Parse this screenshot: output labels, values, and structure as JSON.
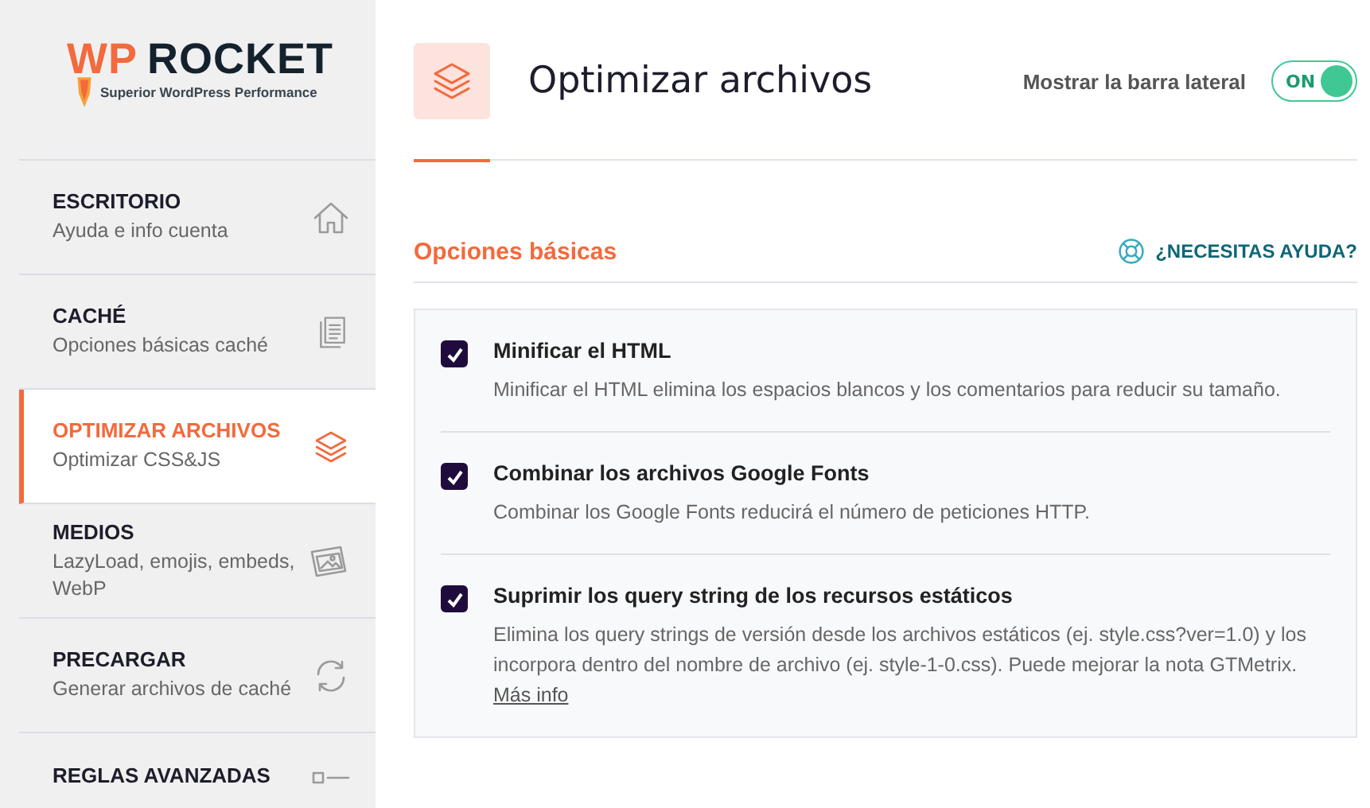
{
  "logo": {
    "brand_accent": "WP",
    "brand": "ROCKET",
    "tagline": "Superior WordPress Performance"
  },
  "sidebar": {
    "items": [
      {
        "title": "ESCRITORIO",
        "subtitle": "Ayuda e info cuenta",
        "selected": false
      },
      {
        "title": "CACHÉ",
        "subtitle": "Opciones básicas caché",
        "selected": false
      },
      {
        "title": "OPTIMIZAR ARCHIVOS",
        "subtitle": "Optimizar CSS&JS",
        "selected": true
      },
      {
        "title": "MEDIOS",
        "subtitle": "LazyLoad, emojis, embeds, WebP",
        "selected": false
      },
      {
        "title": "PRECARGAR",
        "subtitle": "Generar archivos de caché",
        "selected": false
      },
      {
        "title": "REGLAS AVANZADAS",
        "selected": false
      }
    ]
  },
  "header": {
    "title": "Optimizar archivos",
    "sidebar_toggle": {
      "label": "Mostrar la barra lateral",
      "state_text": "ON",
      "on": true
    }
  },
  "section": {
    "title": "Opciones básicas",
    "help_link": "¿NECESITAS AYUDA?",
    "options": [
      {
        "title": "Minificar el HTML",
        "description": "Minificar el HTML elimina los espacios blancos y los comentarios para reducir su tamaño.",
        "checked": true
      },
      {
        "title": "Combinar los archivos Google Fonts",
        "description": "Combinar los Google Fonts reducirá el número de peticiones HTTP.",
        "checked": true
      },
      {
        "title": "Suprimir los query string de los recursos estáticos",
        "description": "Elimina los query strings de versión desde los archivos estáticos (ej. style.css?ver=1.0) y los incorpora dentro del nombre de archivo (ej. style-1-0.css). Puede mejorar la nota GTMetrix.",
        "link": "Más info",
        "checked": true
      }
    ]
  }
}
